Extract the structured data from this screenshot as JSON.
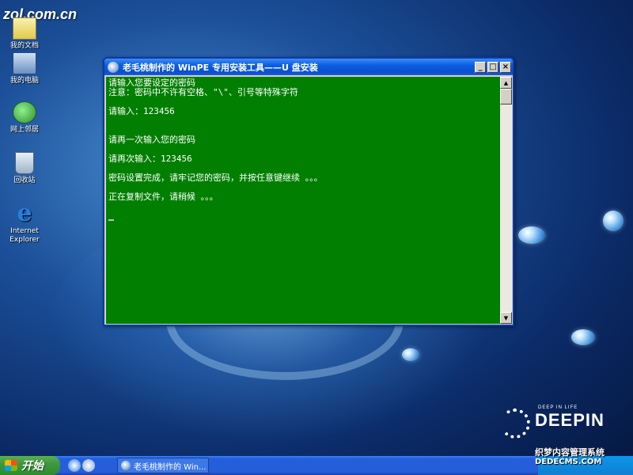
{
  "watermark": {
    "zol": "zol.com.cn",
    "deepin_tagline": "DEEP IN LIFE",
    "deepin_word": "DEEPIN",
    "bottom_site": "织梦内容管理系统",
    "bottom_url": "DEDECMS.COM"
  },
  "desktop_icons": [
    {
      "label": "我的文档",
      "icon": "documents-icon"
    },
    {
      "label": "我的电脑",
      "icon": "computer-icon"
    },
    {
      "label": "网上邻居",
      "icon": "network-icon"
    },
    {
      "label": "回收站",
      "icon": "recycle-bin-icon"
    },
    {
      "label": "Internet Explorer",
      "icon": "ie-icon"
    }
  ],
  "window": {
    "title": "老毛桃制作的 WinPE 专用安装工具——U 盘安装",
    "minimize": "_",
    "maximize": "□",
    "close": "×",
    "lines": [
      "请输入您要设定的密码",
      "注意：密码中不许有空格、\"\\\"、引号等特殊字符",
      "",
      "请输入：123456",
      "",
      "",
      "请再一次输入您的密码",
      "",
      "请再次输入：123456",
      "",
      "密码设置完成，请牢记您的密码，并按任意键继续 。。。",
      "",
      "正在复制文件，请稍候 。。。",
      ""
    ]
  },
  "taskbar": {
    "start_label": "开始",
    "task_label": "老毛桃制作的 Win...",
    "colors": {
      "start": "#3c9a3c",
      "bar": "#245edb"
    }
  },
  "console_color": "#007f00"
}
